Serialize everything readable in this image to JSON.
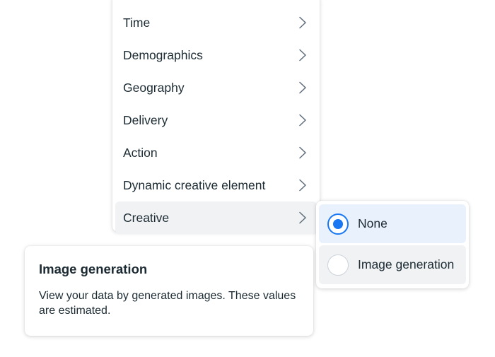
{
  "menu": {
    "items": [
      {
        "label": "Time"
      },
      {
        "label": "Demographics"
      },
      {
        "label": "Geography"
      },
      {
        "label": "Delivery"
      },
      {
        "label": "Action"
      },
      {
        "label": "Dynamic creative element"
      },
      {
        "label": "Creative"
      }
    ],
    "active_item": "Creative"
  },
  "submenu": {
    "options": [
      {
        "label": "None",
        "selected": true
      },
      {
        "label": "Image generation",
        "selected": false
      }
    ]
  },
  "tooltip": {
    "title": "Image generation",
    "body": "View your data by generated images. These values are estimated."
  },
  "colors": {
    "accent": "#1877f2",
    "selected_bg": "#e9f1fc",
    "hover_bg": "#f1f2f4",
    "text": "#1c2b33"
  }
}
